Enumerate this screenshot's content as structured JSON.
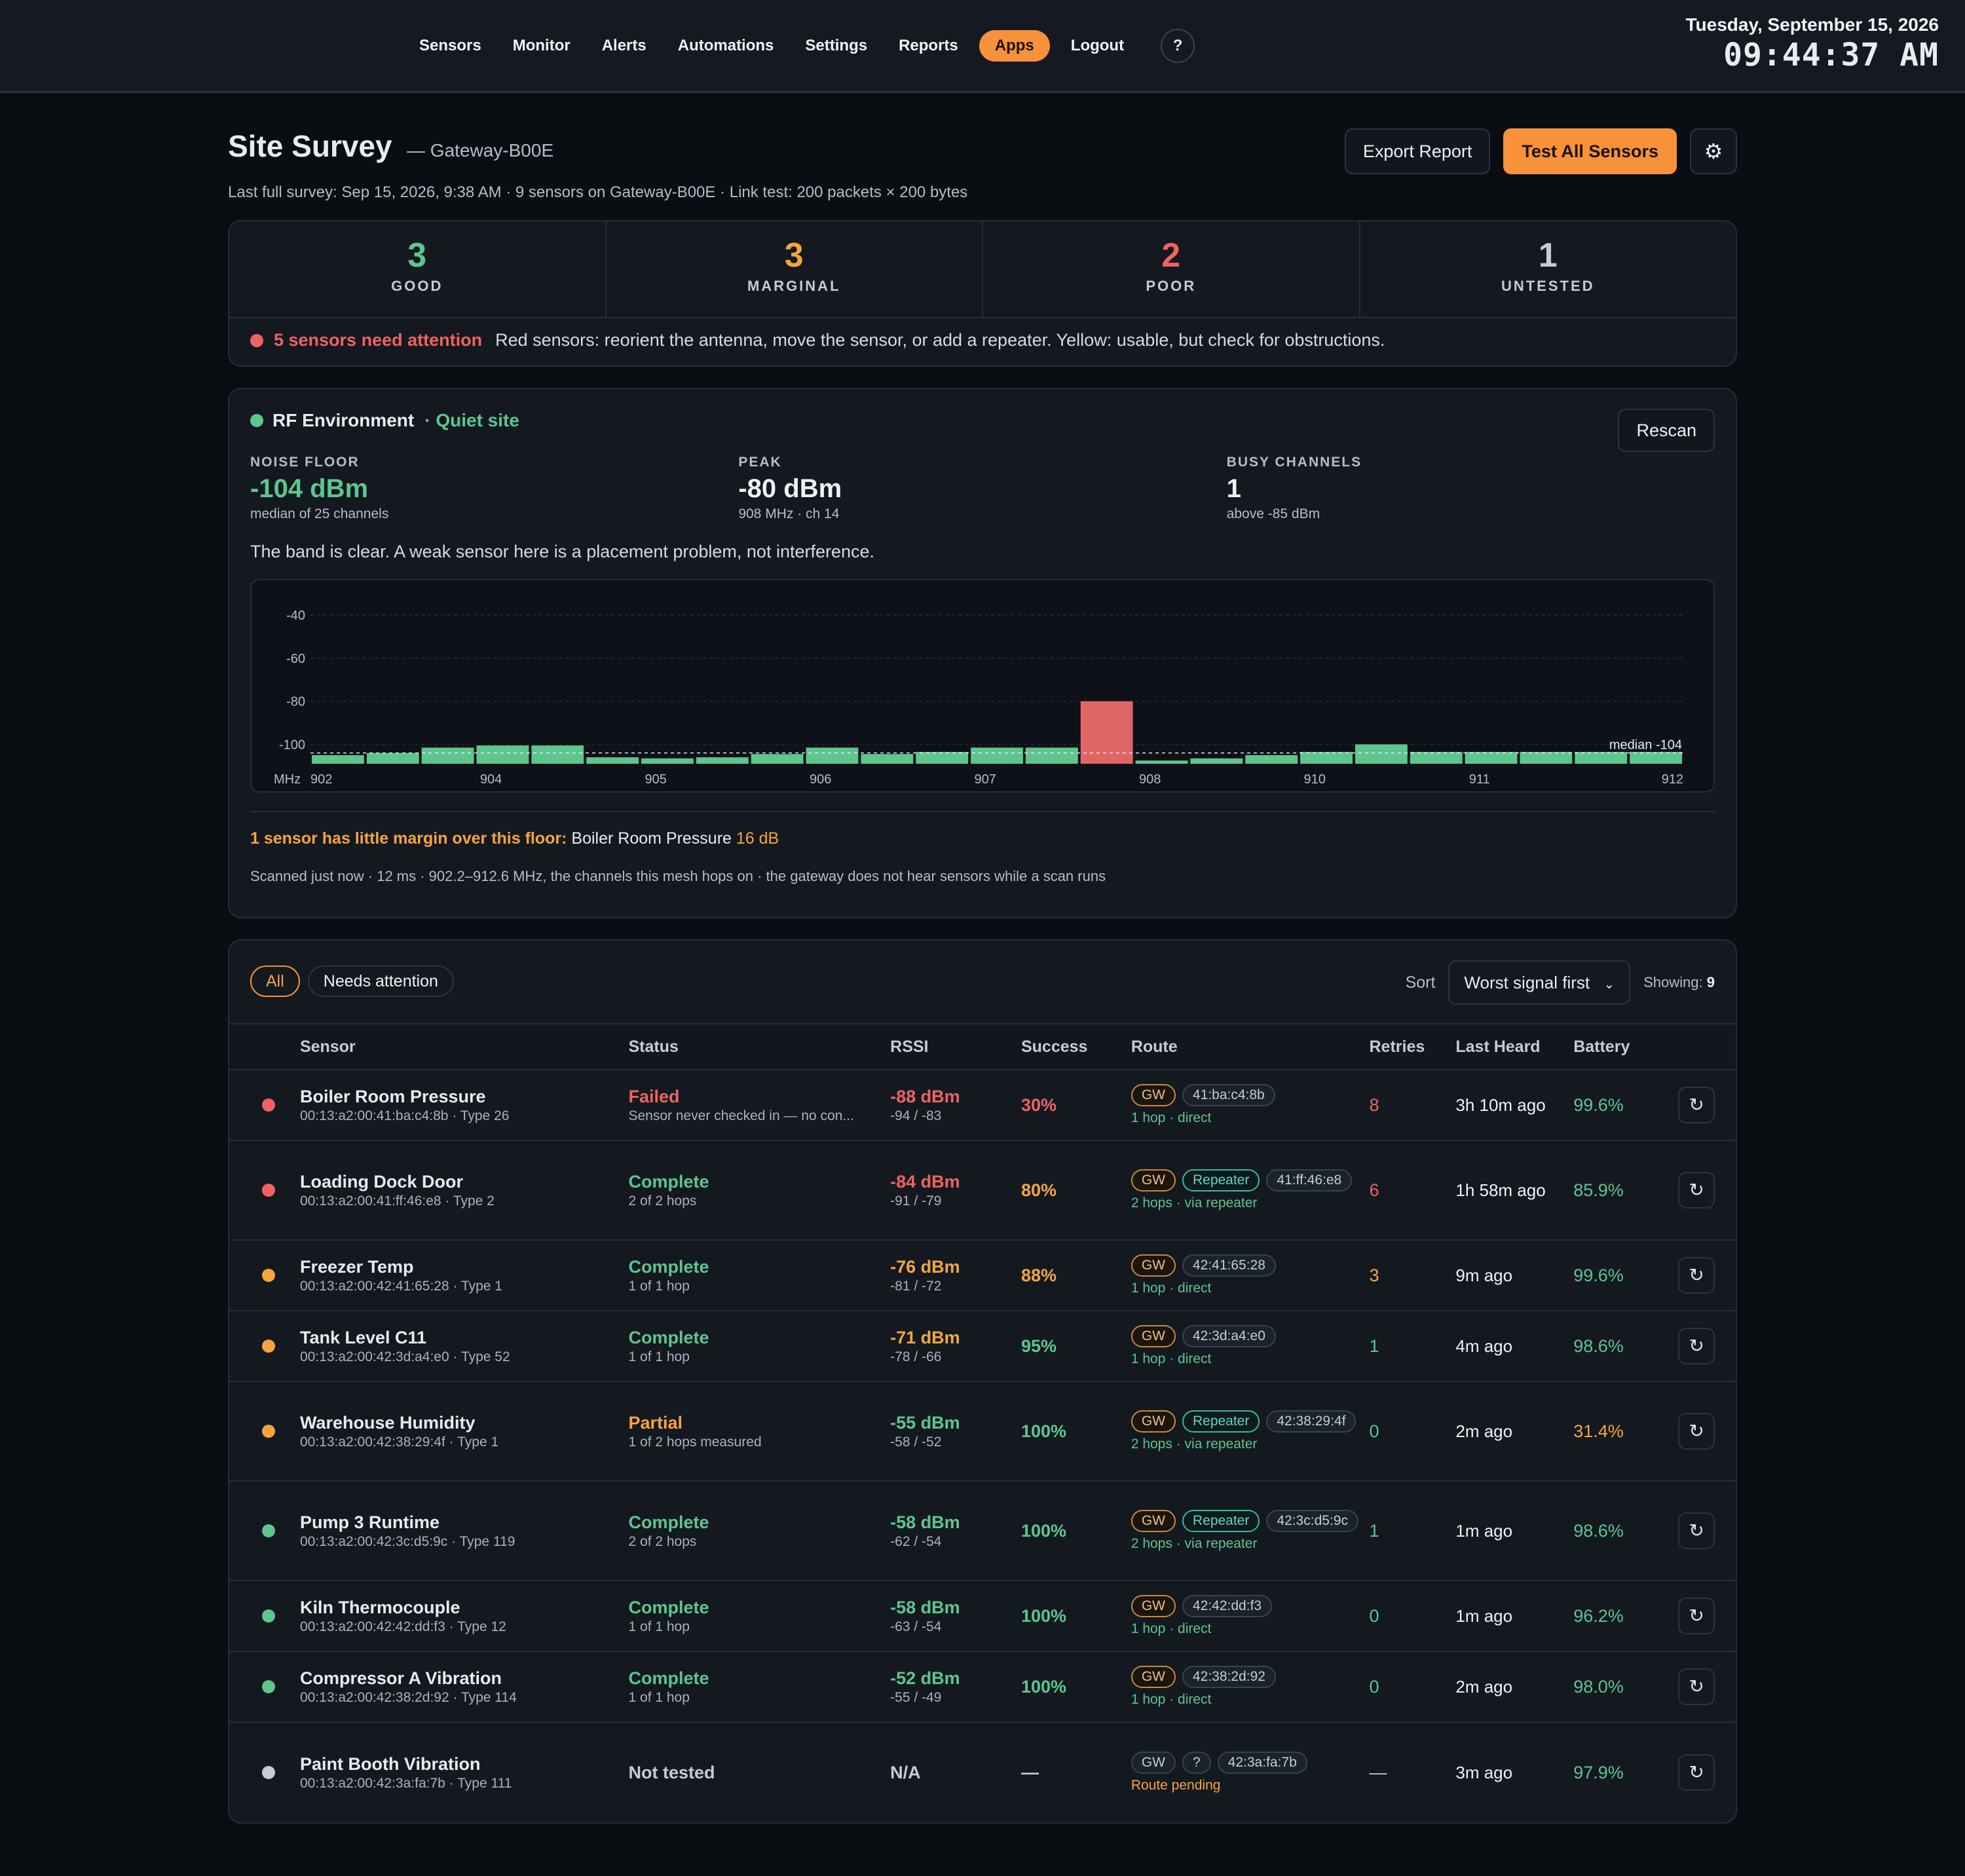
{
  "nav": {
    "items": [
      {
        "label": "Sensors",
        "active": false
      },
      {
        "label": "Monitor",
        "active": false
      },
      {
        "label": "Alerts",
        "active": false
      },
      {
        "label": "Automations",
        "active": false
      },
      {
        "label": "Settings",
        "active": false
      },
      {
        "label": "Reports",
        "active": false
      },
      {
        "label": "Apps",
        "active": true
      },
      {
        "label": "Logout",
        "active": false
      }
    ],
    "help_label": "?"
  },
  "clock": {
    "date": "Tuesday, September 15, 2026",
    "time": "09:44:37 AM"
  },
  "page": {
    "title": "Site Survey",
    "subtitle": "— Gateway-B00E",
    "meta": "Last full survey: Sep 15, 2026, 9:38 AM · 9 sensors on Gateway-B00E · Link test: 200 packets × 200 bytes",
    "export_label": "Export Report",
    "test_all_label": "Test All Sensors",
    "settings_icon": "gear-icon"
  },
  "summary": {
    "stats": [
      {
        "value": "3",
        "label": "GOOD",
        "color": "#5ec58f"
      },
      {
        "value": "3",
        "label": "MARGINAL",
        "color": "#f7a43f"
      },
      {
        "value": "2",
        "label": "POOR",
        "color": "#f06262"
      },
      {
        "value": "1",
        "label": "UNTESTED",
        "color": "#c6ccd6"
      }
    ],
    "attention_title": "5 sensors need attention",
    "attention_text": "Red sensors: reorient the antenna, move the sensor, or add a repeater. Yellow: usable, but check for obstructions."
  },
  "rf": {
    "title": "RF Environment",
    "status": "· Quiet site",
    "rescan_label": "Rescan",
    "metrics": [
      {
        "label": "NOISE FLOOR",
        "value": "-104 dBm",
        "sub": "median of 25 channels",
        "color": "#5ec58f"
      },
      {
        "label": "PEAK",
        "value": "-80 dBm",
        "sub": "908 MHz · ch 14",
        "color": "#eef1f5"
      },
      {
        "label": "BUSY CHANNELS",
        "value": "1",
        "sub": "above -85 dBm",
        "color": "#eef1f5"
      }
    ],
    "note": "The band is clear. A weak sensor here is a placement problem, not interference.",
    "warn_title": "1 sensor has little margin over this floor:",
    "warn_sensor": "Boiler Room Pressure",
    "warn_value": "16 dB",
    "footer": "Scanned just now · 12 ms · 902.2–912.6 MHz, the channels this mesh hops on · the gateway does not hear sensors while a scan runs"
  },
  "chart_data": {
    "type": "bar",
    "y_ticks": [
      "-40",
      "-60",
      "-80",
      "-100"
    ],
    "ylim": [
      -109,
      -33
    ],
    "x_unit_label": "MHz",
    "x_tick_labels": [
      "902",
      "904",
      "905",
      "906",
      "907",
      "908",
      "910",
      "911",
      "912"
    ],
    "median_label": "median -104",
    "median_value": -104,
    "busy_threshold": -85,
    "values": [
      -105,
      -104,
      -101.5,
      -100.5,
      -100.5,
      -106,
      -106.5,
      -106,
      -104.5,
      -101.5,
      -104.5,
      -103.5,
      -101.5,
      -101.5,
      -80,
      -107.5,
      -106.5,
      -105,
      -103.5,
      -100,
      -103.5,
      -103.5,
      -103.5,
      -103.5,
      -103.5
    ],
    "colors": {
      "normal": "#5ec58f",
      "busy": "#e06666"
    }
  },
  "table": {
    "filters": [
      {
        "label": "All",
        "active": true
      },
      {
        "label": "Needs attention",
        "active": false
      }
    ],
    "sort_label": "Sort",
    "sort_value": "Worst signal first",
    "showing_label": "Showing:",
    "showing_count": "9",
    "headers": {
      "sensor": "Sensor",
      "status": "Status",
      "rssi": "RSSI",
      "success": "Success",
      "route": "Route",
      "retries": "Retries",
      "last_heard": "Last Heard",
      "battery": "Battery"
    },
    "rows": [
      {
        "dot": "#f06262",
        "name": "Boiler Room Pressure",
        "id": "00:13:a2:00:41:ba:c4:8b · Type 26",
        "status": "Failed",
        "status_color": "#f06262",
        "status_sub": "Sensor never checked in — no con...",
        "rssi": "-88 dBm",
        "rssi_color": "#f06262",
        "rssi_sub": "-94 / -83",
        "success": "30%",
        "success_color": "#f06262",
        "route_badges": [
          {
            "t": "GW",
            "k": "gw"
          },
          {
            "t": "41:ba:c4:8b",
            "k": "neutral"
          }
        ],
        "route_note": "1 hop · direct",
        "route_note_color": "#5ec58f",
        "retries": "8",
        "retries_color": "#f06262",
        "last_heard": "3h 10m ago",
        "battery": "99.6%",
        "battery_color": "#5ec58f"
      },
      {
        "dot": "#f06262",
        "name": "Loading Dock Door",
        "id": "00:13:a2:00:41:ff:46:e8 · Type 2",
        "status": "Complete",
        "status_color": "#5ec58f",
        "status_sub": "2 of 2 hops",
        "rssi": "-84 dBm",
        "rssi_color": "#f06262",
        "rssi_sub": "-91 / -79",
        "success": "80%",
        "success_color": "#f7a43f",
        "route_badges": [
          {
            "t": "GW",
            "k": "gw"
          },
          {
            "t": "Repeater",
            "k": "rep"
          },
          {
            "t": "41:ff:46:e8",
            "k": "neutral"
          }
        ],
        "route_note": "2 hops · via repeater",
        "route_note_color": "#5ec58f",
        "retries": "6",
        "retries_color": "#f06262",
        "last_heard": "1h 58m ago",
        "battery": "85.9%",
        "battery_color": "#5ec58f"
      },
      {
        "dot": "#f7a43f",
        "name": "Freezer Temp",
        "id": "00:13:a2:00:42:41:65:28 · Type 1",
        "status": "Complete",
        "status_color": "#5ec58f",
        "status_sub": "1 of 1 hop",
        "rssi": "-76 dBm",
        "rssi_color": "#f7a43f",
        "rssi_sub": "-81 / -72",
        "success": "88%",
        "success_color": "#f7a43f",
        "route_badges": [
          {
            "t": "GW",
            "k": "gw"
          },
          {
            "t": "42:41:65:28",
            "k": "neutral"
          }
        ],
        "route_note": "1 hop · direct",
        "route_note_color": "#5ec58f",
        "retries": "3",
        "retries_color": "#f7a43f",
        "last_heard": "9m ago",
        "battery": "99.6%",
        "battery_color": "#5ec58f"
      },
      {
        "dot": "#f7a43f",
        "name": "Tank Level C11",
        "id": "00:13:a2:00:42:3d:a4:e0 · Type 52",
        "status": "Complete",
        "status_color": "#5ec58f",
        "status_sub": "1 of 1 hop",
        "rssi": "-71 dBm",
        "rssi_color": "#f7a43f",
        "rssi_sub": "-78 / -66",
        "success": "95%",
        "success_color": "#5ec58f",
        "route_badges": [
          {
            "t": "GW",
            "k": "gw"
          },
          {
            "t": "42:3d:a4:e0",
            "k": "neutral"
          }
        ],
        "route_note": "1 hop · direct",
        "route_note_color": "#5ec58f",
        "retries": "1",
        "retries_color": "#5ec58f",
        "last_heard": "4m ago",
        "battery": "98.6%",
        "battery_color": "#5ec58f"
      },
      {
        "dot": "#f7a43f",
        "name": "Warehouse Humidity",
        "id": "00:13:a2:00:42:38:29:4f · Type 1",
        "status": "Partial",
        "status_color": "#f7a43f",
        "status_sub": "1 of 2 hops measured",
        "rssi": "-55 dBm",
        "rssi_color": "#5ec58f",
        "rssi_sub": "-58 / -52",
        "success": "100%",
        "success_color": "#5ec58f",
        "route_badges": [
          {
            "t": "GW",
            "k": "gw"
          },
          {
            "t": "Repeater",
            "k": "rep"
          },
          {
            "t": "42:38:29:4f",
            "k": "neutral"
          }
        ],
        "route_note": "2 hops · via repeater",
        "route_note_color": "#5ec58f",
        "retries": "0",
        "retries_color": "#5ec58f",
        "last_heard": "2m ago",
        "battery": "31.4%",
        "battery_color": "#f7a43f"
      },
      {
        "dot": "#5ec58f",
        "name": "Pump 3 Runtime",
        "id": "00:13:a2:00:42:3c:d5:9c · Type 119",
        "status": "Complete",
        "status_color": "#5ec58f",
        "status_sub": "2 of 2 hops",
        "rssi": "-58 dBm",
        "rssi_color": "#5ec58f",
        "rssi_sub": "-62 / -54",
        "success": "100%",
        "success_color": "#5ec58f",
        "route_badges": [
          {
            "t": "GW",
            "k": "gw"
          },
          {
            "t": "Repeater",
            "k": "rep"
          },
          {
            "t": "42:3c:d5:9c",
            "k": "neutral"
          }
        ],
        "route_note": "2 hops · via repeater",
        "route_note_color": "#5ec58f",
        "retries": "1",
        "retries_color": "#5ec58f",
        "last_heard": "1m ago",
        "battery": "98.6%",
        "battery_color": "#5ec58f"
      },
      {
        "dot": "#5ec58f",
        "name": "Kiln Thermocouple",
        "id": "00:13:a2:00:42:42:dd:f3 · Type 12",
        "status": "Complete",
        "status_color": "#5ec58f",
        "status_sub": "1 of 1 hop",
        "rssi": "-58 dBm",
        "rssi_color": "#5ec58f",
        "rssi_sub": "-63 / -54",
        "success": "100%",
        "success_color": "#5ec58f",
        "route_badges": [
          {
            "t": "GW",
            "k": "gw"
          },
          {
            "t": "42:42:dd:f3",
            "k": "neutral"
          }
        ],
        "route_note": "1 hop · direct",
        "route_note_color": "#5ec58f",
        "retries": "0",
        "retries_color": "#5ec58f",
        "last_heard": "1m ago",
        "battery": "96.2%",
        "battery_color": "#5ec58f"
      },
      {
        "dot": "#5ec58f",
        "name": "Compressor A Vibration",
        "id": "00:13:a2:00:42:38:2d:92 · Type 114",
        "status": "Complete",
        "status_color": "#5ec58f",
        "status_sub": "1 of 1 hop",
        "rssi": "-52 dBm",
        "rssi_color": "#5ec58f",
        "rssi_sub": "-55 / -49",
        "success": "100%",
        "success_color": "#5ec58f",
        "route_badges": [
          {
            "t": "GW",
            "k": "gw"
          },
          {
            "t": "42:38:2d:92",
            "k": "neutral"
          }
        ],
        "route_note": "1 hop · direct",
        "route_note_color": "#5ec58f",
        "retries": "0",
        "retries_color": "#5ec58f",
        "last_heard": "2m ago",
        "battery": "98.0%",
        "battery_color": "#5ec58f"
      },
      {
        "dot": "#c6ccd6",
        "name": "Paint Booth Vibration",
        "id": "00:13:a2:00:42:3a:fa:7b · Type 111",
        "status": "Not tested",
        "status_color": "#c6ccd6",
        "status_sub": "",
        "rssi": "N/A",
        "rssi_color": "#c6ccd6",
        "rssi_sub": "",
        "success": "—",
        "success_color": "#c6ccd6",
        "route_badges": [
          {
            "t": "GW",
            "k": "neutral"
          },
          {
            "t": "?",
            "k": "neutral"
          },
          {
            "t": "42:3a:fa:7b",
            "k": "neutral"
          }
        ],
        "route_note": "Route pending",
        "route_note_color": "#f7a43f",
        "retries": "—",
        "retries_color": "#c6ccd6",
        "last_heard": "3m ago",
        "battery": "97.9%",
        "battery_color": "#5ec58f"
      }
    ]
  }
}
